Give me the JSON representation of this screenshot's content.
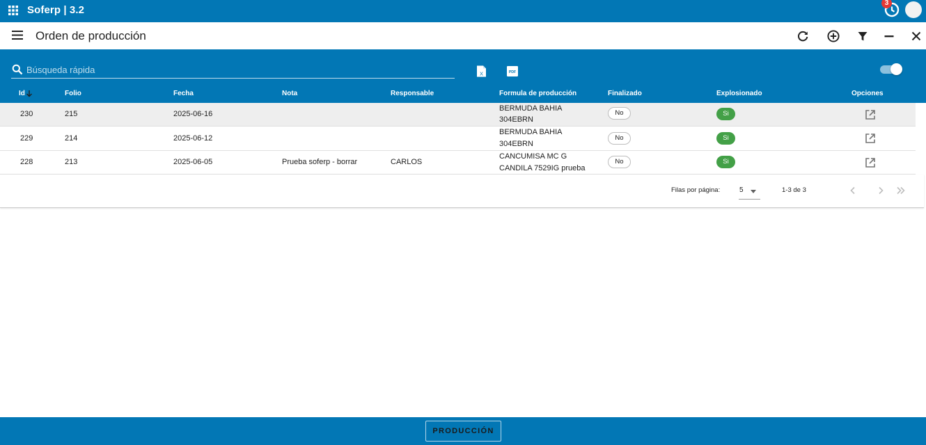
{
  "app": {
    "title": "Soferp | 3.2",
    "notification_count": "3"
  },
  "page": {
    "title": "Orden de producción"
  },
  "toolbar": {
    "icons": [
      "refresh-icon",
      "add-circle-icon",
      "filter-icon",
      "minimize-icon",
      "close-icon"
    ]
  },
  "search": {
    "placeholder": "Búsqueda rápida",
    "value": ""
  },
  "export": {
    "xls_icon": "excel-file-icon",
    "pdf_icon": "pdf-file-icon",
    "pdf_text": "PDF"
  },
  "toggle": {
    "on": true
  },
  "table": {
    "columns": {
      "id": "Id",
      "folio": "Folio",
      "fecha": "Fecha",
      "nota": "Nota",
      "responsable": "Responsable",
      "formula": "Formula de producción",
      "finalizado": "Finalizado",
      "explosionado": "Explosionado",
      "opciones": "Opciones"
    },
    "rows": [
      {
        "id": "230",
        "folio": "215",
        "fecha": "2025-06-16",
        "nota": "",
        "responsable": "",
        "formula_1": "BERMUDA BAHIA",
        "formula_2": "304EBRN",
        "finalizado": "No",
        "explosionado": "Si"
      },
      {
        "id": "229",
        "folio": "214",
        "fecha": "2025-06-12",
        "nota": "",
        "responsable": "",
        "formula_1": "BERMUDA BAHIA",
        "formula_2": "304EBRN",
        "finalizado": "No",
        "explosionado": "Si"
      },
      {
        "id": "228",
        "folio": "213",
        "fecha": "2025-06-05",
        "nota": "Prueba soferp - borrar",
        "responsable": "CARLOS",
        "formula_1": "CANCUMISA MC G",
        "formula_2": "CANDILA 7529IG prueba",
        "finalizado": "No",
        "explosionado": "Si"
      }
    ]
  },
  "pagination": {
    "rows_per_page_label": "Filas por página:",
    "rows_per_page": "5",
    "range": "1-3 de 3"
  },
  "bottom": {
    "button_label": "PRODUCCIÓN"
  },
  "colors": {
    "primary": "#0277b5",
    "success": "#43a047",
    "badge": "#e53935"
  }
}
